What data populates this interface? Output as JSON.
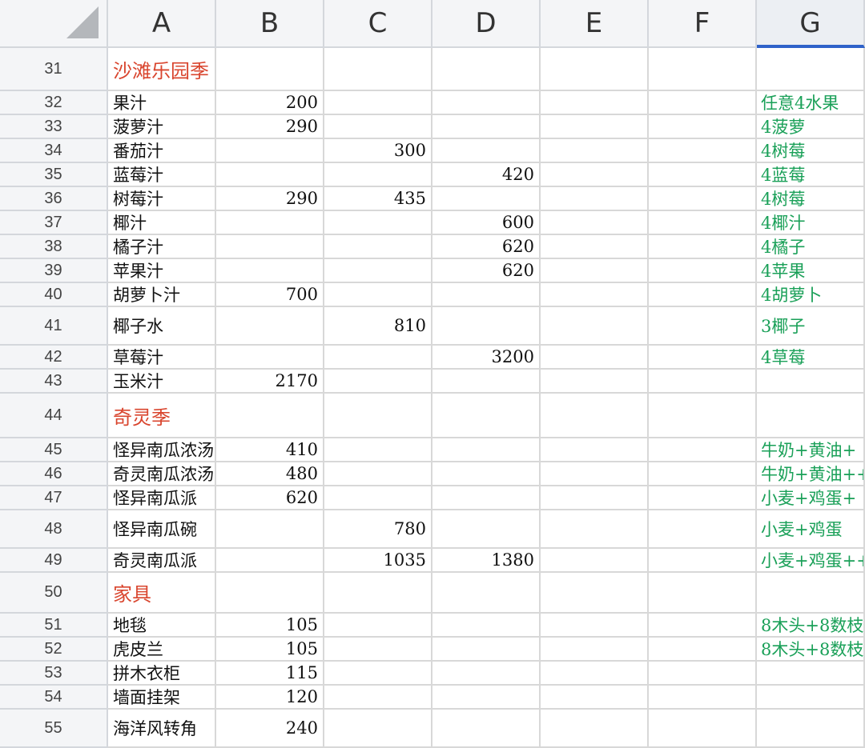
{
  "columns": [
    "A",
    "B",
    "C",
    "D",
    "E",
    "F",
    "G"
  ],
  "selected_column": "G",
  "colors": {
    "section_text": "#d9452e",
    "note_text": "#1aa058",
    "selection": "#2f62c9"
  },
  "rows": [
    {
      "num": "31",
      "A": "沙滩乐园季",
      "B": "",
      "C": "",
      "D": "",
      "G": "",
      "section": true
    },
    {
      "num": "32",
      "A": "果汁",
      "B": "200",
      "C": "",
      "D": "",
      "G": "任意4水果"
    },
    {
      "num": "33",
      "A": "菠萝汁",
      "B": "290",
      "C": "",
      "D": "",
      "G": "4菠萝"
    },
    {
      "num": "34",
      "A": "番茄汁",
      "B": "",
      "C": "300",
      "D": "",
      "G": "4树莓"
    },
    {
      "num": "35",
      "A": "蓝莓汁",
      "B": "",
      "C": "",
      "D": "420",
      "G": "4蓝莓"
    },
    {
      "num": "36",
      "A": "树莓汁",
      "B": "290",
      "C": "435",
      "D": "",
      "G": "4树莓"
    },
    {
      "num": "37",
      "A": "椰汁",
      "B": "",
      "C": "",
      "D": "600",
      "G": "4椰汁"
    },
    {
      "num": "38",
      "A": "橘子汁",
      "B": "",
      "C": "",
      "D": "620",
      "G": "4橘子"
    },
    {
      "num": "39",
      "A": "苹果汁",
      "B": "",
      "C": "",
      "D": "620",
      "G": "4苹果"
    },
    {
      "num": "40",
      "A": "胡萝卜汁",
      "B": "700",
      "C": "",
      "D": "",
      "G": "4胡萝卜"
    },
    {
      "num": "41",
      "A": "椰子水",
      "B": "",
      "C": "810",
      "D": "",
      "G": "3椰子"
    },
    {
      "num": "42",
      "A": "草莓汁",
      "B": "",
      "C": "",
      "D": "3200",
      "G": "4草莓"
    },
    {
      "num": "43",
      "A": "玉米汁",
      "B": "2170",
      "C": "",
      "D": "",
      "G": ""
    },
    {
      "num": "44",
      "A": "奇灵季",
      "B": "",
      "C": "",
      "D": "",
      "G": "",
      "section": true
    },
    {
      "num": "45",
      "A": "怪异南瓜浓汤",
      "B": "410",
      "C": "",
      "D": "",
      "G": "牛奶+黄油+"
    },
    {
      "num": "46",
      "A": "奇灵南瓜浓汤",
      "B": "480",
      "C": "",
      "D": "",
      "G": "牛奶+黄油++"
    },
    {
      "num": "47",
      "A": "怪异南瓜派",
      "B": "620",
      "C": "",
      "D": "",
      "G": "小麦+鸡蛋+"
    },
    {
      "num": "48",
      "A": "怪异南瓜碗",
      "B": "",
      "C": "780",
      "D": "",
      "G": "小麦+鸡蛋"
    },
    {
      "num": "49",
      "A": "奇灵南瓜派",
      "B": "",
      "C": "1035",
      "D": "1380",
      "G": "小麦+鸡蛋++"
    },
    {
      "num": "50",
      "A": "家具",
      "B": "",
      "C": "",
      "D": "",
      "G": "",
      "section": true
    },
    {
      "num": "51",
      "A": "地毯",
      "B": "105",
      "C": "",
      "D": "",
      "G": "8木头+8数枝"
    },
    {
      "num": "52",
      "A": "虎皮兰",
      "B": "105",
      "C": "",
      "D": "",
      "G": "8木头+8数枝"
    },
    {
      "num": "53",
      "A": "拼木衣柜",
      "B": "115",
      "C": "",
      "D": "",
      "G": ""
    },
    {
      "num": "54",
      "A": "墙面挂架",
      "B": "120",
      "C": "",
      "D": "",
      "G": ""
    },
    {
      "num": "55",
      "A": "海洋风转角",
      "B": "240",
      "C": "",
      "D": "",
      "G": ""
    }
  ]
}
